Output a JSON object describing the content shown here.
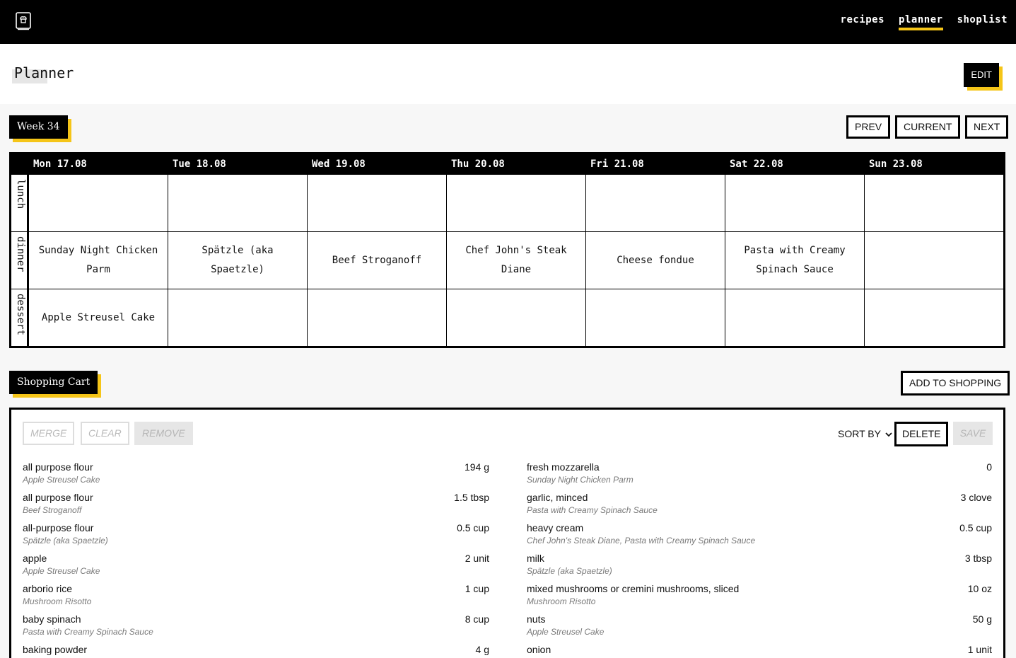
{
  "nav": {
    "items": [
      {
        "label": "recipes",
        "active": false
      },
      {
        "label": "planner",
        "active": true
      },
      {
        "label": "shoplist",
        "active": false
      }
    ],
    "logo_icon": "recipe-book-icon"
  },
  "header": {
    "title": "Planner",
    "edit_label": "EDIT"
  },
  "week": {
    "label": "Week 34",
    "prev": "PREV",
    "current": "CURRENT",
    "next": "NEXT"
  },
  "planner": {
    "days": [
      "Mon 17.08",
      "Tue 18.08",
      "Wed 19.08",
      "Thu 20.08",
      "Fri 21.08",
      "Sat 22.08",
      "Sun 23.08"
    ],
    "meals": [
      "lunch",
      "dinner",
      "dessert"
    ],
    "grid": {
      "lunch": [
        "",
        "",
        "",
        "",
        "",
        "",
        ""
      ],
      "dinner": [
        "Sunday Night Chicken Parm",
        "Spätzle (aka Spaetzle)",
        "Beef Stroganoff",
        "Chef John's Steak Diane",
        "Cheese fondue",
        "Pasta with Creamy Spinach Sauce",
        ""
      ],
      "dessert": [
        "Apple Streusel Cake",
        "",
        "",
        "",
        "",
        "",
        ""
      ]
    }
  },
  "cart": {
    "label": "Shopping Cart",
    "add_to_shopping": "ADD TO SHOPPING",
    "merge": "MERGE",
    "clear": "CLEAR",
    "remove": "REMOVE",
    "sort_by": "SORT BY",
    "delete": "DELETE",
    "save": "SAVE",
    "left_items": [
      {
        "name": "all purpose flour",
        "source": "Apple Streusel Cake",
        "qty": "194 g"
      },
      {
        "name": "all purpose flour",
        "source": "Beef Stroganoff",
        "qty": "1.5 tbsp"
      },
      {
        "name": "all-purpose flour",
        "source": "Spätzle (aka Spaetzle)",
        "qty": "0.5 cup"
      },
      {
        "name": "apple",
        "source": "Apple Streusel Cake",
        "qty": "2 unit"
      },
      {
        "name": "arborio rice",
        "source": "Mushroom Risotto",
        "qty": "1 cup"
      },
      {
        "name": "baby spinach",
        "source": "Pasta with Creamy Spinach Sauce",
        "qty": "8 cup"
      },
      {
        "name": "baking powder",
        "source": "",
        "qty": "4 g"
      }
    ],
    "right_items": [
      {
        "name": "fresh mozzarella",
        "source": "Sunday Night Chicken Parm",
        "qty": "0"
      },
      {
        "name": "garlic, minced",
        "source": "Pasta with Creamy Spinach Sauce",
        "qty": "3 clove"
      },
      {
        "name": "heavy cream",
        "source": "Chef John's Steak Diane, Pasta with Creamy Spinach Sauce",
        "qty": "0.5 cup"
      },
      {
        "name": "milk",
        "source": "Spätzle (aka Spaetzle)",
        "qty": "3 tbsp"
      },
      {
        "name": "mixed mushrooms or cremini mushrooms, sliced",
        "source": "Mushroom Risotto",
        "qty": "10 oz"
      },
      {
        "name": "nuts",
        "source": "Apple Streusel Cake",
        "qty": "50 g"
      },
      {
        "name": "onion",
        "source": "",
        "qty": "1 unit"
      }
    ]
  },
  "colors": {
    "accent": "#f5c518",
    "primary": "#000000",
    "background": "#f7f7f7"
  }
}
